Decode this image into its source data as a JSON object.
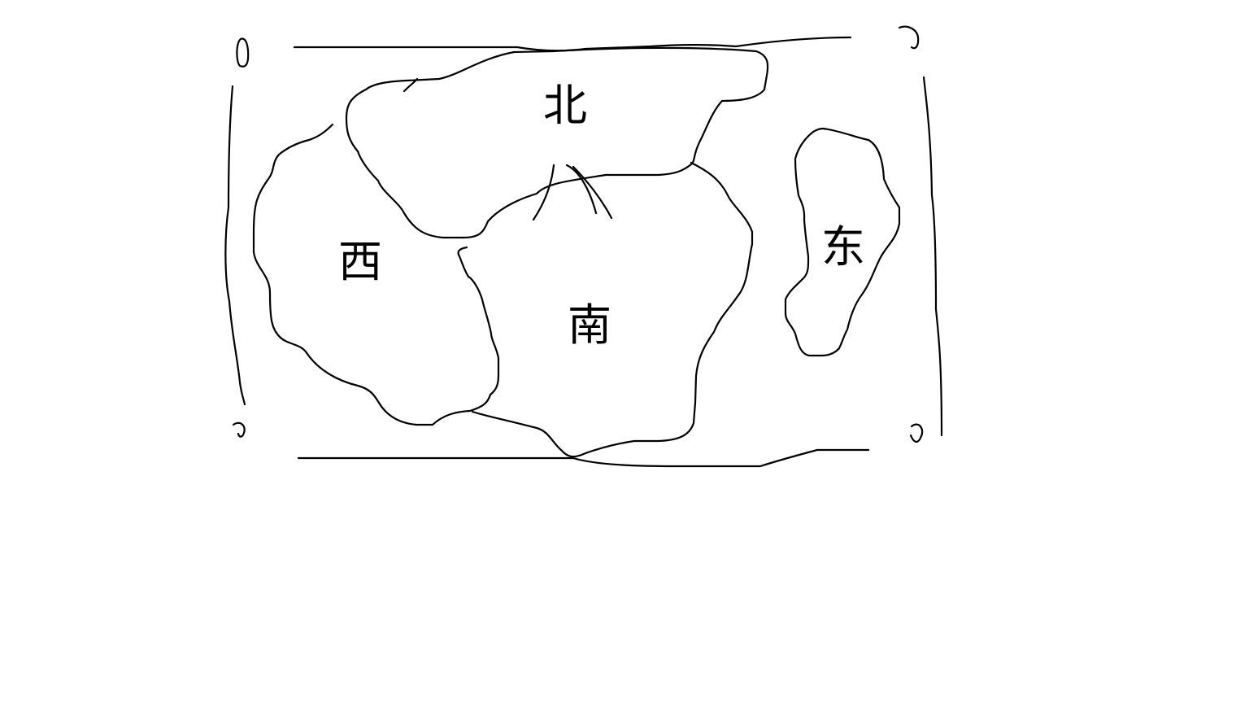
{
  "diagram": {
    "regions": [
      {
        "key": "north",
        "label": "北"
      },
      {
        "key": "west",
        "label": "西"
      },
      {
        "key": "south",
        "label": "南"
      },
      {
        "key": "east",
        "label": "东"
      }
    ],
    "center_mark": {
      "label": "八"
    },
    "corner_marks": [
      "0",
      "0",
      "0",
      "0"
    ]
  }
}
